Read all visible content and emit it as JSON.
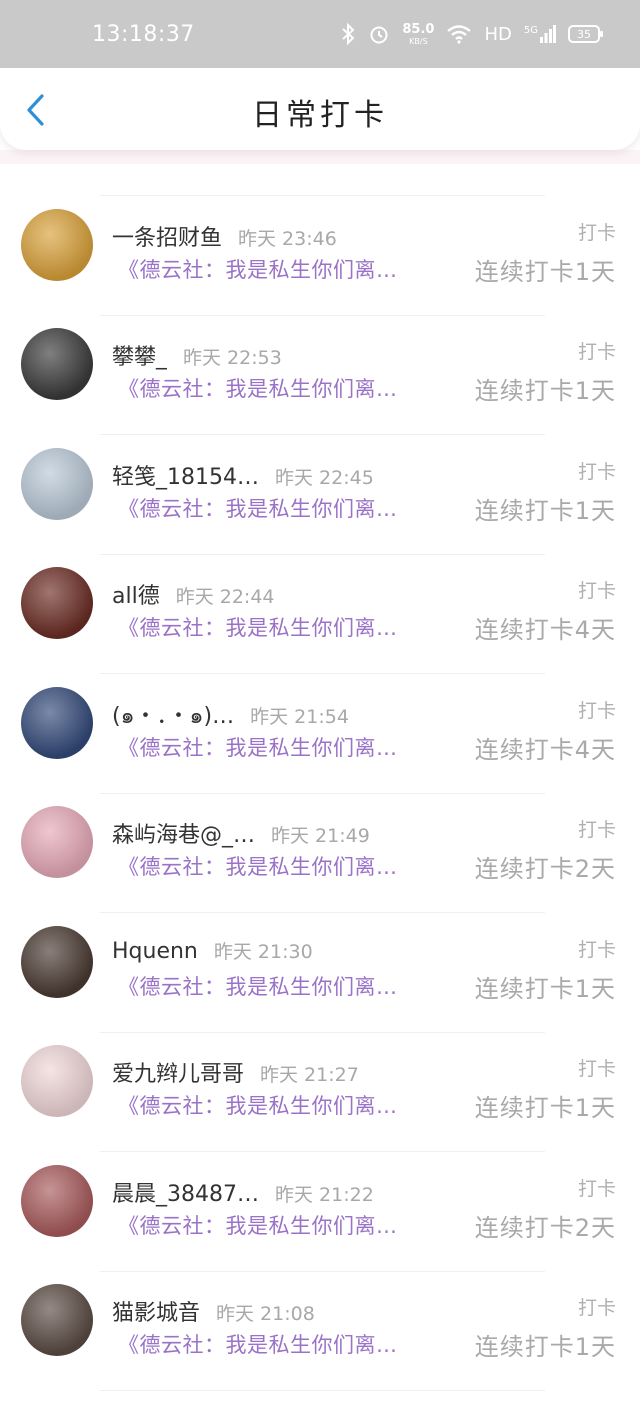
{
  "status_bar": {
    "time": "13:18:37",
    "speed_value": "85.0",
    "speed_unit": "KB/S",
    "network_hd": "HD",
    "network_5g": "5G",
    "battery": "35"
  },
  "header": {
    "title": "日常打卡",
    "back_icon": "chevron-left-icon"
  },
  "colors": {
    "accent": "#2f8fd6",
    "content_purple": "#9a72c8",
    "status_bar_bg": "#c9c9c9"
  },
  "entries": [
    {
      "name": "",
      "time": "",
      "label": "打卡",
      "content": "《德云社：我是私生你们离…",
      "streak": "连续打卡1天",
      "avatar": "#1a1a1a"
    },
    {
      "name": "一条招财鱼",
      "time": "昨天 23:46",
      "label": "打卡",
      "content": "《德云社：我是私生你们离…",
      "streak": "连续打卡1天",
      "avatar": "#d9a13a"
    },
    {
      "name": "攀攀_",
      "time": "昨天 22:53",
      "label": "打卡",
      "content": "《德云社：我是私生你们离…",
      "streak": "连续打卡1天",
      "avatar": "#3b3b3b"
    },
    {
      "name": "轻笺_18154…",
      "time": "昨天 22:45",
      "label": "打卡",
      "content": "《德云社：我是私生你们离…",
      "streak": "连续打卡1天",
      "avatar": "#b9c8d6"
    },
    {
      "name": "all德",
      "time": "昨天 22:44",
      "label": "打卡",
      "content": "《德云社：我是私生你们离…",
      "streak": "连续打卡4天",
      "avatar": "#6b2d23"
    },
    {
      "name": "(๑・．・๑)…",
      "time": "昨天 21:54",
      "label": "打卡",
      "content": "《德云社：我是私生你们离…",
      "streak": "连续打卡4天",
      "avatar": "#334a7a"
    },
    {
      "name": "森屿海巷@_…",
      "time": "昨天 21:49",
      "label": "打卡",
      "content": "《德云社：我是私生你们离…",
      "streak": "连续打卡2天",
      "avatar": "#e6a9b8"
    },
    {
      "name": "Hquenn",
      "time": "昨天 21:30",
      "label": "打卡",
      "content": "《德云社：我是私生你们离…",
      "streak": "连续打卡1天",
      "avatar": "#4a3a32"
    },
    {
      "name": "爱九辫儿哥哥",
      "time": "昨天 21:27",
      "label": "打卡",
      "content": "《德云社：我是私生你们离…",
      "streak": "连续打卡1天",
      "avatar": "#f0d6d8"
    },
    {
      "name": "晨晨_38487…",
      "time": "昨天 21:22",
      "label": "打卡",
      "content": "《德云社：我是私生你们离…",
      "streak": "连续打卡2天",
      "avatar": "#a85a5c"
    },
    {
      "name": "猫影城音",
      "time": "昨天 21:08",
      "label": "打卡",
      "content": "《德云社：我是私生你们离…",
      "streak": "连续打卡1天",
      "avatar": "#5b4b44"
    }
  ]
}
